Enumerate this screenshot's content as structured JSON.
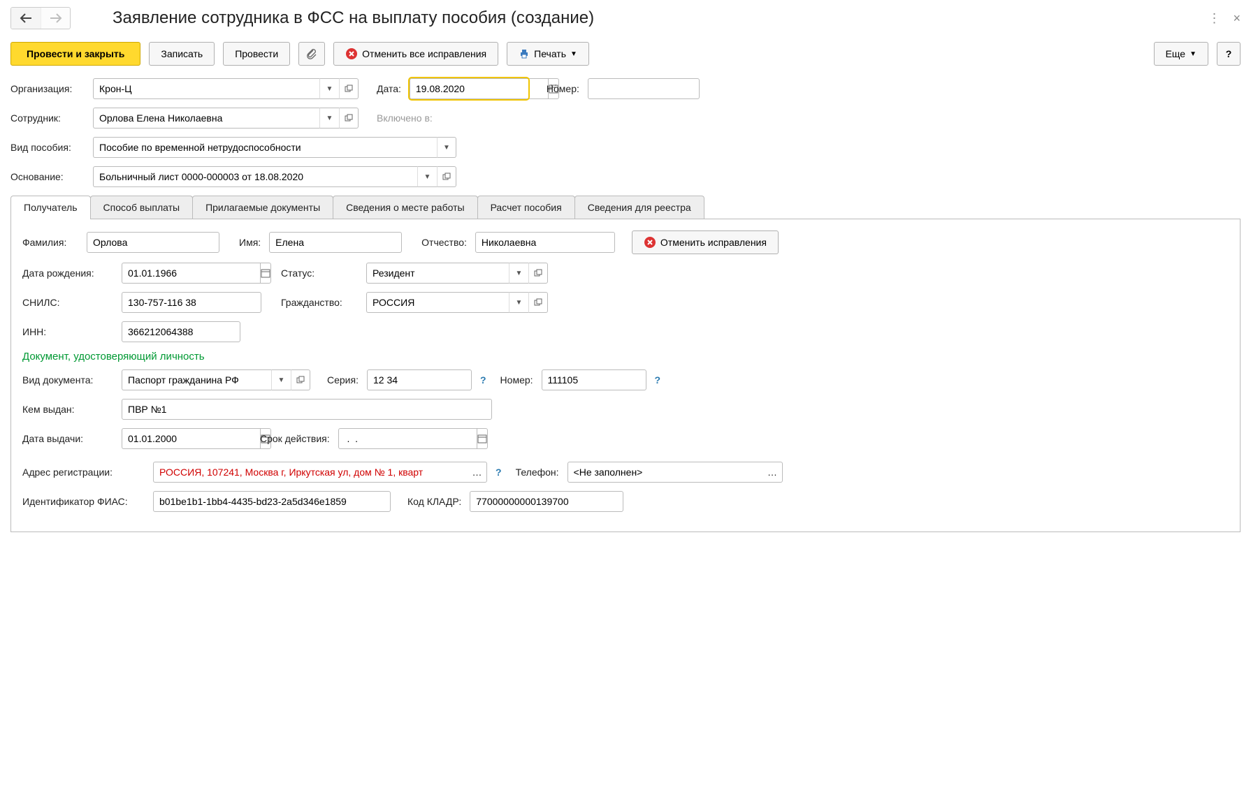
{
  "title": "Заявление сотрудника в ФСС на выплату пособия (создание)",
  "toolbar": {
    "submit_close": "Провести и закрыть",
    "save": "Записать",
    "submit": "Провести",
    "cancel_all": "Отменить все исправления",
    "print": "Печать",
    "more": "Еще",
    "help": "?"
  },
  "fields": {
    "org_label": "Организация:",
    "org_value": "Крон-Ц",
    "date_label": "Дата:",
    "date_value": "19.08.2020",
    "number_label": "Номер:",
    "number_value": "",
    "employee_label": "Сотрудник:",
    "employee_value": "Орлова Елена Николаевна",
    "included_label": "Включено в:",
    "benefit_type_label": "Вид пособия:",
    "benefit_type_value": "Пособие по временной нетрудоспособности",
    "basis_label": "Основание:",
    "basis_value": "Больничный лист 0000-000003 от 18.08.2020"
  },
  "tabs": {
    "t1": "Получатель",
    "t2": "Способ выплаты",
    "t3": "Прилагаемые документы",
    "t4": "Сведения о месте работы",
    "t5": "Расчет пособия",
    "t6": "Сведения для реестра"
  },
  "recipient": {
    "lastname_label": "Фамилия:",
    "lastname": "Орлова",
    "firstname_label": "Имя:",
    "firstname": "Елена",
    "middlename_label": "Отчество:",
    "middlename": "Николаевна",
    "cancel_btn": "Отменить исправления",
    "dob_label": "Дата рождения:",
    "dob": "01.01.1966",
    "status_label": "Статус:",
    "status": "Резидент",
    "snils_label": "СНИЛС:",
    "snils": "130-757-116 38",
    "citizenship_label": "Гражданство:",
    "citizenship": "РОССИЯ",
    "inn_label": "ИНН:",
    "inn": "366212064388",
    "id_section": "Документ, удостоверяющий личность",
    "doc_type_label": "Вид документа:",
    "doc_type": "Паспорт гражданина РФ",
    "series_label": "Серия:",
    "series": "12 34",
    "doc_number_label": "Номер:",
    "doc_number": "111105",
    "issued_by_label": "Кем выдан:",
    "issued_by": "ПВР №1",
    "issue_date_label": "Дата выдачи:",
    "issue_date": "01.01.2000",
    "expiry_label": "Срок действия:",
    "expiry": " .  .",
    "address_label": "Адрес регистрации:",
    "address": "РОССИЯ, 107241, Москва г, Иркутская ул, дом № 1, кварт",
    "phone_label": "Телефон:",
    "phone": "<Не заполнен>",
    "fias_label": "Идентификатор ФИАС:",
    "fias": "b01be1b1-1bb4-4435-bd23-2a5d346e1859",
    "kladr_label": "Код КЛАДР:",
    "kladr": "77000000000139700"
  }
}
